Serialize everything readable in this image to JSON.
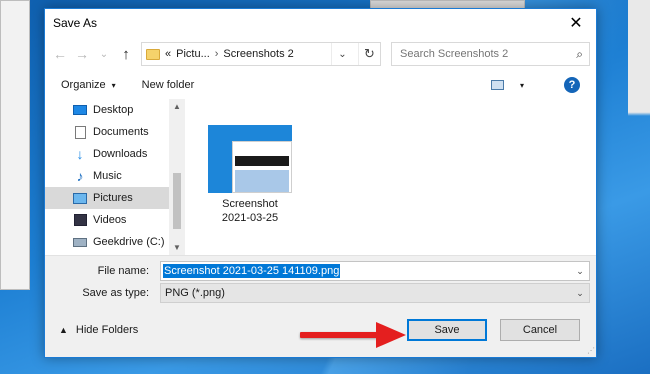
{
  "dialog": {
    "title": "Save As",
    "close_glyph": "✕"
  },
  "address": {
    "back_glyph": "←",
    "forward_glyph": "→",
    "history_glyph": "⌄",
    "up_glyph": "↑",
    "overflow": "«",
    "crumbs": [
      "Pictu...",
      "Screenshots 2"
    ],
    "separator": "›",
    "dropdown_glyph": "⌄",
    "refresh_glyph": "↻"
  },
  "search": {
    "placeholder": "Search Screenshots 2",
    "icon_glyph": "⌕"
  },
  "toolbar": {
    "organize_label": "Organize",
    "organize_caret": "▾",
    "new_folder_label": "New folder",
    "view_caret": "▾",
    "help_glyph": "?"
  },
  "sidebar": {
    "items": [
      {
        "label": "Desktop",
        "icon": "desktop-icon"
      },
      {
        "label": "Documents",
        "icon": "documents-icon"
      },
      {
        "label": "Downloads",
        "icon": "downloads-icon"
      },
      {
        "label": "Music",
        "icon": "music-icon"
      },
      {
        "label": "Pictures",
        "icon": "pictures-icon",
        "selected": true
      },
      {
        "label": "Videos",
        "icon": "videos-icon"
      },
      {
        "label": "Geekdrive (C:)",
        "icon": "drive-icon"
      }
    ],
    "scroll_up": "▲",
    "scroll_down": "▼"
  },
  "files": [
    {
      "line1": "Screenshot",
      "line2": "2021-03-25"
    }
  ],
  "save": {
    "filename_label": "File name:",
    "filename_value": "Screenshot 2021-03-25 141109.png",
    "type_label": "Save as type:",
    "type_value": "PNG (*.png)",
    "dd_glyph": "⌄"
  },
  "footer": {
    "hide_folders_label": "Hide Folders",
    "hide_caret": "▲",
    "save_label": "Save",
    "cancel_label": "Cancel"
  },
  "colors": {
    "accent": "#0078d7",
    "arrow": "#e41f1f",
    "desktop": "#1f7ccf"
  }
}
